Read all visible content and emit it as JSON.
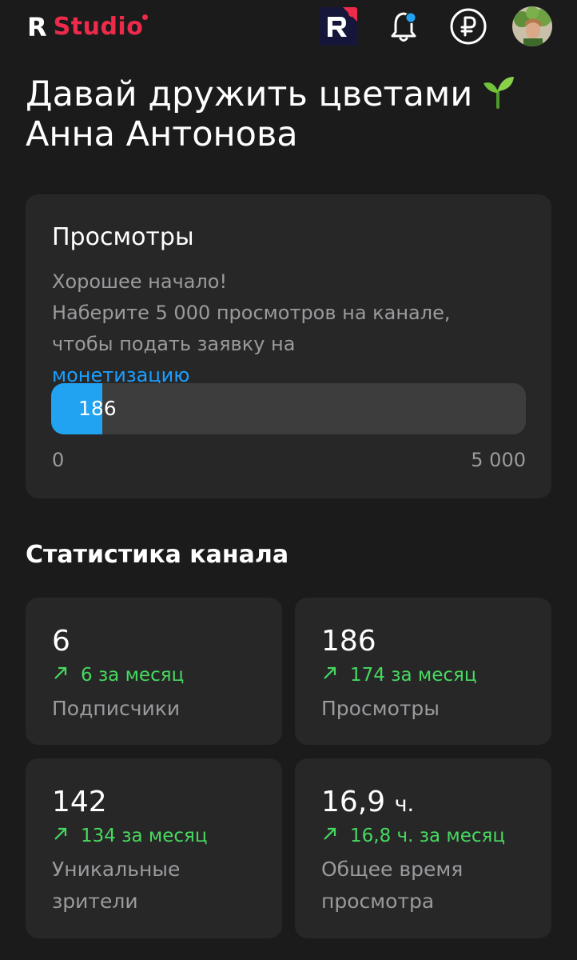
{
  "header": {
    "logo_r": "R",
    "logo_studio": "Studio",
    "icons": [
      "rutube-app-icon",
      "bell-icon",
      "ruble-icon",
      "avatar"
    ],
    "accent": "#ee2a4b"
  },
  "channel": {
    "title_line1": "Давай дружить цветами",
    "title_line2": "Анна Антонова",
    "emoji_icon": "sprout-icon"
  },
  "views_card": {
    "title": "Просмотры",
    "desc_line1": "Хорошее начало!",
    "desc_line2": "Наберите 5 000 просмотров на канале,",
    "desc_line3": "чтобы подать заявку на",
    "link_text": "монетизацию",
    "progress_value": 186,
    "progress_max": 5000,
    "progress_label": "186",
    "scale_min": "0",
    "scale_max": "5 000",
    "progress_color": "#22a3f2",
    "link_color": "#1a9fff"
  },
  "stats": {
    "heading": "Статистика канала",
    "delta_color": "#47d95f",
    "items": [
      {
        "value": "6",
        "unit": "",
        "delta": "6 за месяц",
        "label": "Подписчики"
      },
      {
        "value": "186",
        "unit": "",
        "delta": "174 за месяц",
        "label": "Просмотры"
      },
      {
        "value": "142",
        "unit": "",
        "delta": "134 за месяц",
        "label": "Уникальные зрители"
      },
      {
        "value": "16,9",
        "unit": "ч.",
        "delta": "16,8 ч. за месяц",
        "label": "Общее время просмотра"
      }
    ]
  }
}
